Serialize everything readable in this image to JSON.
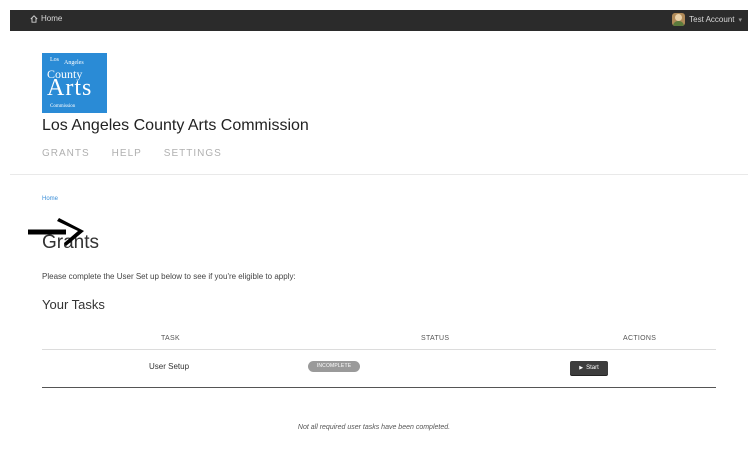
{
  "topbar": {
    "home_label": "Home",
    "account_label": "Test Account",
    "account_caret": "▾"
  },
  "logo": {
    "line1a": "Los",
    "line1b": "Angeles",
    "line2": "County",
    "line3": "Arts",
    "line4": "Commission"
  },
  "org_title": "Los Angeles County Arts Commission",
  "nav": {
    "items": [
      "GRANTS",
      "HELP",
      "SETTINGS"
    ]
  },
  "breadcrumb": "Home",
  "page_heading": "Grants",
  "intro_text": "Please complete the User Set up below to see if you're eligible to apply:",
  "tasks": {
    "heading": "Your Tasks",
    "columns": [
      "TASK",
      "STATUS",
      "ACTIONS"
    ],
    "rows": [
      {
        "task": "User Setup",
        "status": "INCOMPLETE",
        "action": "Start"
      }
    ]
  },
  "footer_note": "Not all required user tasks have been completed.",
  "colors": {
    "topbar_bg": "#2b2b2b",
    "logo_bg": "#2a8bd6",
    "link": "#3a8ed8",
    "badge_bg": "#9a9a9a",
    "button_bg": "#3d3d3d"
  }
}
